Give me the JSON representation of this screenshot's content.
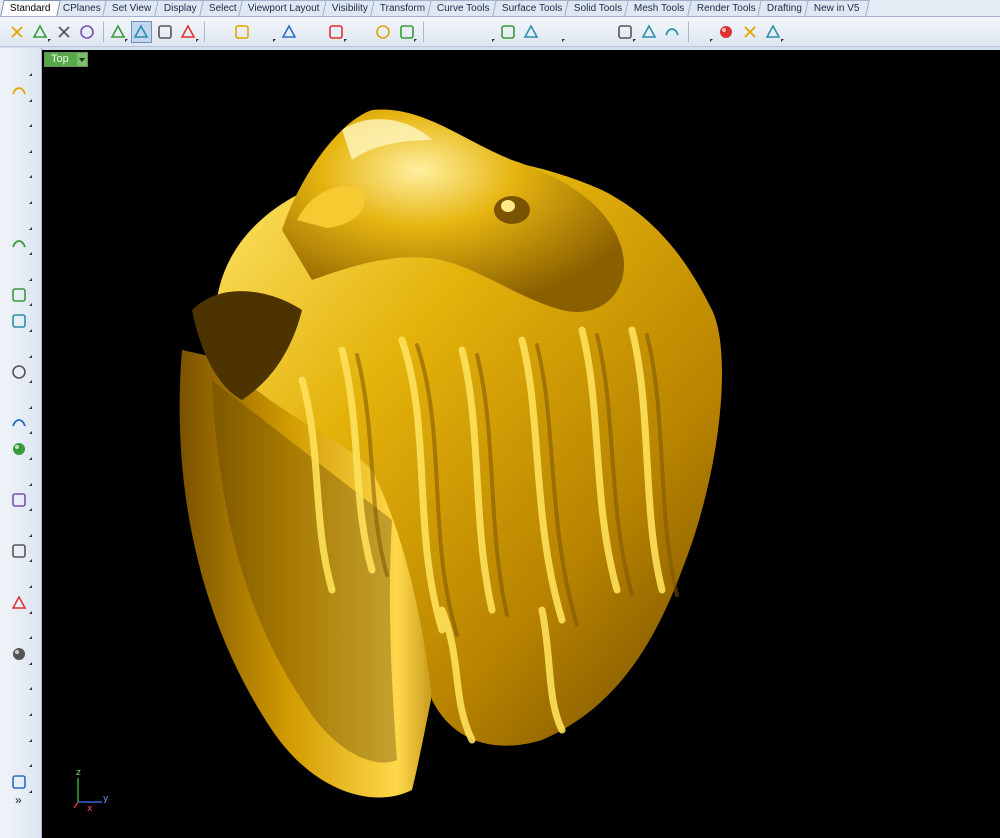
{
  "tabs": [
    {
      "label": "Standard",
      "active": true
    },
    {
      "label": "CPlanes"
    },
    {
      "label": "Set View"
    },
    {
      "label": "Display"
    },
    {
      "label": "Select"
    },
    {
      "label": "Viewport Layout"
    },
    {
      "label": "Visibility"
    },
    {
      "label": "Transform"
    },
    {
      "label": "Curve Tools"
    },
    {
      "label": "Surface Tools"
    },
    {
      "label": "Solid Tools"
    },
    {
      "label": "Mesh Tools"
    },
    {
      "label": "Render Tools"
    },
    {
      "label": "Drafting"
    },
    {
      "label": "New in V5"
    }
  ],
  "toolbar_icons": [
    "new-document-icon",
    "open-folder-icon",
    "save-icon",
    "print-icon",
    "import-icon",
    "cut-icon",
    "copy-icon",
    "paste-icon",
    "undo-icon",
    "pan-hand-icon",
    "rotate-view-icon",
    "zoom-icon",
    "zoom-window-icon",
    "zoom-extents-icon",
    "zoom-selected-icon",
    "zoom-all-icon",
    "four-viewports-icon",
    "car-object-icon",
    "set-point-icon",
    "circle-icon",
    "snap-points-icon",
    "light-bulb-icon",
    "lock-icon",
    "shade-icon",
    "color-wheel-icon",
    "render-sphere-icon",
    "rendered-sphere-icon",
    "blue-sphere-icon",
    "light-spot-icon",
    "options-gear-icon",
    "sub-d-icon",
    "help-icon"
  ],
  "left_icons": [
    "select-arrow-icon",
    "point-icon",
    "polyline-icon",
    "curve-control-points-icon",
    "circle-icon",
    "ellipse-icon",
    "arc-icon",
    "rectangle-icon",
    "polygon-icon",
    "fillet-curve-icon",
    "surface-from-points-icon",
    "revolve-icon",
    "solid-box-icon",
    "boolean-union-icon",
    "extrude-icon",
    "mesh-plane-icon",
    "explode-icon",
    "trim-icon",
    "split-icon",
    "move-icon",
    "dimension-icon",
    "group-icon",
    "transform-point-icon",
    "rotate-icon",
    "text-icon",
    "align-icon",
    "array-icon",
    "analyze-icon",
    "render-box-icon"
  ],
  "viewport": {
    "title": "Top",
    "more_glyph": "»",
    "axis_labels": {
      "z": "z",
      "x": "x",
      "y": "y"
    }
  },
  "colors": {
    "viewport_bg": "#000000",
    "gold": "#d9a400",
    "active_tab": "#ffffff",
    "viewport_label": "#57a84a"
  }
}
